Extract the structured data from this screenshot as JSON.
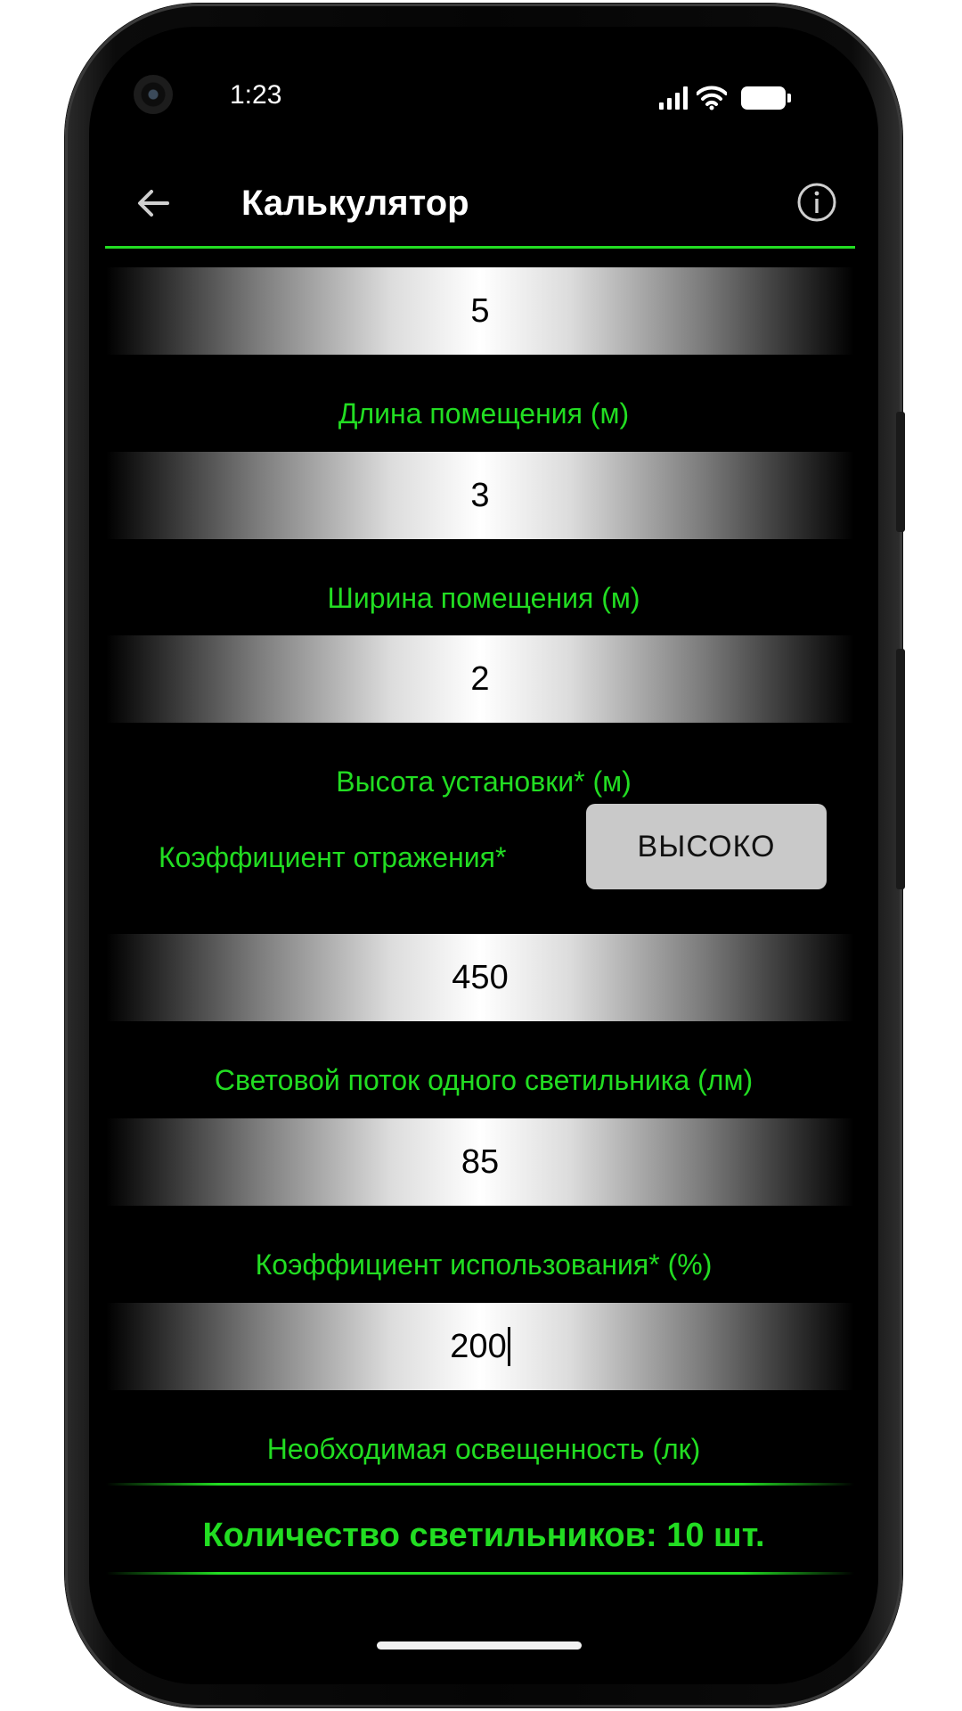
{
  "status_bar": {
    "time": "1:23"
  },
  "app_bar": {
    "title": "Калькулятор",
    "back_icon": "arrow-left-icon",
    "info_icon": "info-icon"
  },
  "fields": [
    {
      "value": "5",
      "label": "Длина помещения (м)"
    },
    {
      "value": "3",
      "label": "Ширина помещения (м)"
    },
    {
      "value": "2",
      "label": "Высота установки* (м)"
    },
    {
      "value": "450",
      "label": "Световой поток одного светильника (лм)"
    },
    {
      "value": "85",
      "label": "Коэффициент использования* (%)"
    },
    {
      "value": "200",
      "label": "Необходимая освещенность (лк)"
    }
  ],
  "reflection": {
    "label": "Коэффициент отражения*",
    "value": "ВЫСОКО"
  },
  "result": {
    "text": "Количество светильников: 10 шт."
  },
  "colors": {
    "accent": "#22dd22",
    "background": "#000000",
    "button": "#c9c9c9"
  }
}
